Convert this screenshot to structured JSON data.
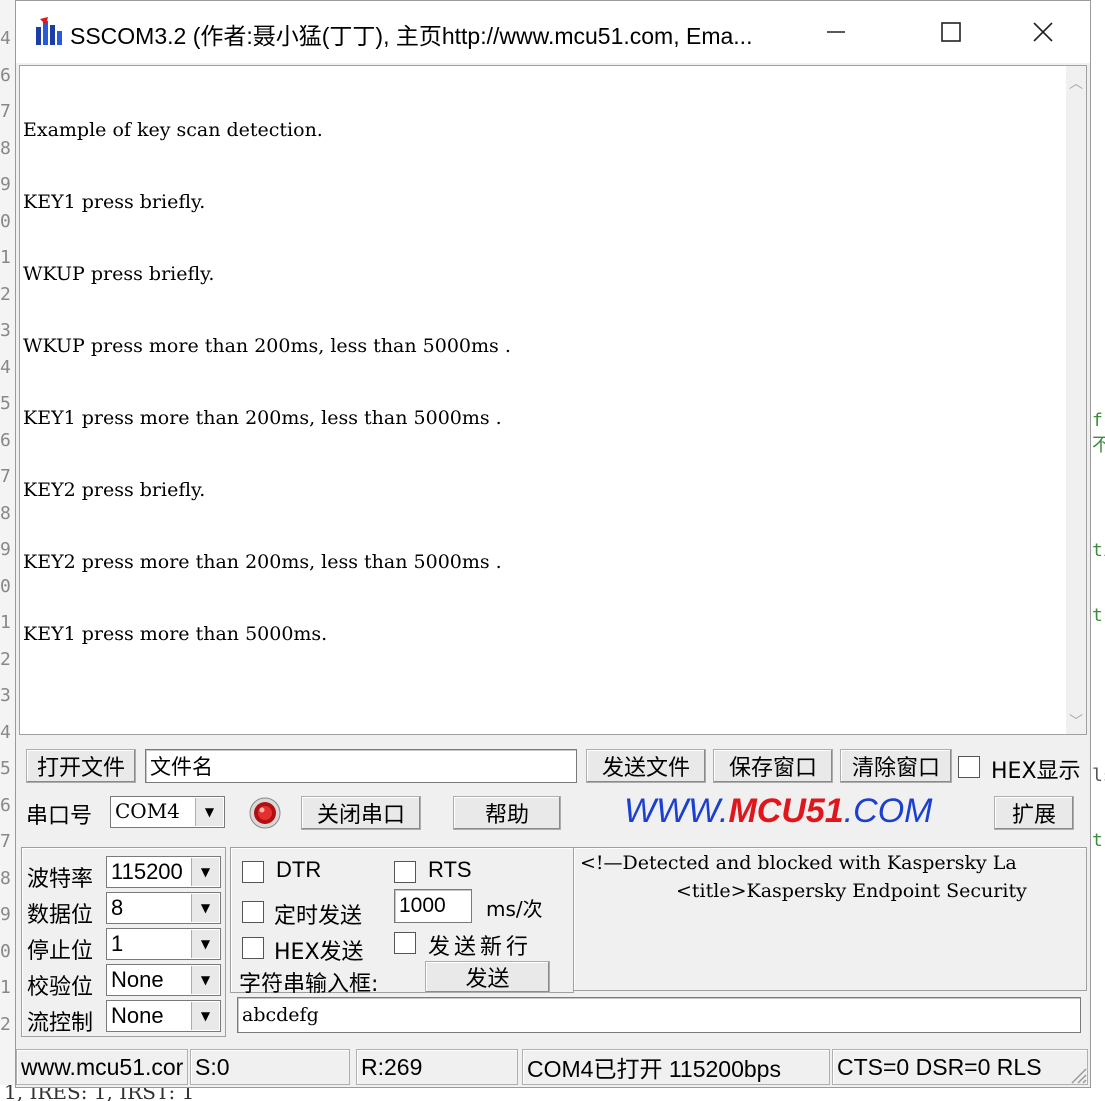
{
  "window": {
    "title": "SSCOM3.2 (作者:聂小猛(丁丁), 主页http://www.mcu51.com,  Ema..."
  },
  "receive": {
    "lines": [
      "Example of key scan detection.",
      "KEY1 press briefly.",
      "WKUP press briefly.",
      "WKUP press more than 200ms, less than 5000ms .",
      "KEY1 press more than 200ms, less than 5000ms .",
      "KEY2 press briefly.",
      "KEY2 press more than 200ms, less than 5000ms .",
      "KEY1 press more than 5000ms."
    ]
  },
  "toolbar1": {
    "open_file": "打开文件",
    "file_name": "文件名",
    "send_file": "发送文件",
    "save_window": "保存窗口",
    "clear_window": "清除窗口",
    "hex_display": "HEX显示"
  },
  "toolbar2": {
    "port_label": "串口号",
    "port_value": "COM4",
    "close_port": "关闭串口",
    "help": "帮助",
    "brand_www": "WWW.",
    "brand_mcu51": "MCU51",
    "brand_com": ".COM",
    "expand": "扩展"
  },
  "settings": {
    "baud_label": "波特率",
    "baud_value": "115200",
    "data_label": "数据位",
    "data_value": "8",
    "stop_label": "停止位",
    "stop_value": "1",
    "parity_label": "校验位",
    "parity_value": "None",
    "flow_label": "流控制",
    "flow_value": "None"
  },
  "send_options": {
    "dtr": "DTR",
    "rts": "RTS",
    "timed_send": "定时发送",
    "interval_value": "1000",
    "interval_unit": "ms/次",
    "hex_send": "HEX发送",
    "send_newline": "发送新行",
    "input_label": "字符串输入框:",
    "send_button": "发送",
    "input_value": "abcdefg"
  },
  "info_panel": {
    "line1": "<!—Detected and blocked with Kaspersky La",
    "line2": "<title>Kaspersky Endpoint Security"
  },
  "status": {
    "url": "www.mcu51.cor",
    "sent": "S:0",
    "received": "R:269",
    "port_state": "COM4已打开  115200bps",
    "signals": "CTS=0 DSR=0 RLS"
  },
  "background": {
    "gutter": [
      "4",
      "6",
      "7",
      "8",
      "9",
      "0",
      "1",
      "2",
      "3",
      "4",
      "5",
      "6",
      "7",
      "8",
      "9",
      "0",
      "1",
      "2",
      "3",
      "4",
      "5",
      "6",
      "7",
      "8",
      "9",
      "0",
      "1",
      "2"
    ],
    "right_fragments": [
      "f不",
      "ti",
      "t",
      "ls",
      "t"
    ],
    "bottom_line": "1, IRES: 1, IRST: 1"
  },
  "colors": {
    "brand_blue": "#1a3fd1",
    "brand_red": "#e0161c"
  }
}
